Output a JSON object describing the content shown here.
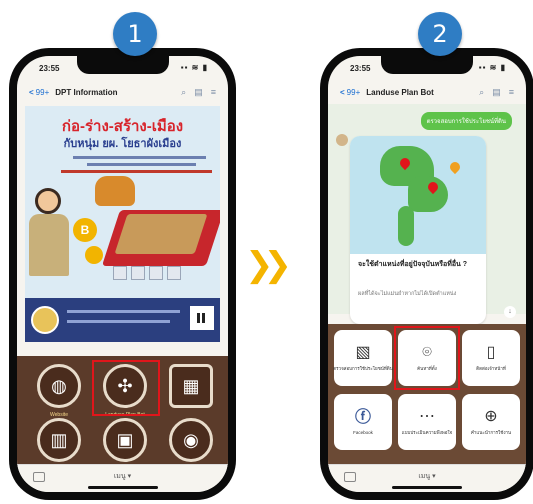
{
  "steps": {
    "first": "1",
    "second": "2"
  },
  "phone1": {
    "time": "23:55",
    "sys_icons": "▪▪ ≋ ▮",
    "back_label": "<",
    "unread_badge": "99+",
    "title": "DPT Information",
    "poster": {
      "headline": "ก่อ-ร่าง-สร้าง-เมือง",
      "subline": "กับหนุ่ม ยผ. โยธาผังเมือง",
      "coin_label": "B"
    },
    "richmenu": {
      "items": [
        {
          "label": "Website",
          "icon": "globe-icon"
        },
        {
          "label": "Landuse Plan Bot",
          "icon": "handshake-icon"
        },
        {
          "label": "",
          "icon": "newspaper-icon"
        },
        {
          "label": "",
          "icon": "book-icon"
        },
        {
          "label": "",
          "icon": "blueprint-icon"
        },
        {
          "label": "",
          "icon": "camera-icon"
        }
      ]
    },
    "menu_label": "เมนู ▾"
  },
  "phone2": {
    "time": "23:55",
    "sys_icons": "▪▪ ≋ ▮",
    "back_label": "<",
    "unread_badge": "99+",
    "title": "Landuse Plan Bot",
    "user_message": "ตรวจสอบการใช้ประโยชน์ที่ดิน",
    "card_title": "จะใช้ตำแหน่งที่อยู่ปัจจุบันหรือที่อื่น ?",
    "card_sub": "ผลที่ได้จะไม่แม่นยำหากไม่ได้เปิดตำแหน่ง",
    "richmenu": {
      "items": [
        {
          "label": "ตรวจสอบการใช้ประโยชน์ที่ดิน",
          "icon": "map-icon"
        },
        {
          "label": "ค้นหาที่ตั้ง",
          "icon": "location-pin-icon"
        },
        {
          "label": "ติดต่อเจ้าหน้าที่",
          "icon": "phone-chat-icon"
        },
        {
          "label": "Facebook",
          "icon": "facebook-icon"
        },
        {
          "label": "แบบประเมินความพึงพอใจ",
          "icon": "rating-icon"
        },
        {
          "label": "คำแนะนำการใช้งาน",
          "icon": "help-icon"
        }
      ]
    },
    "menu_label": "เมนู ▾"
  },
  "colors": {
    "accent_blue": "#2f7dc4",
    "highlight_red": "#e0161b",
    "arrow_yellow": "#f4b400",
    "line_green": "#5ec34a"
  }
}
